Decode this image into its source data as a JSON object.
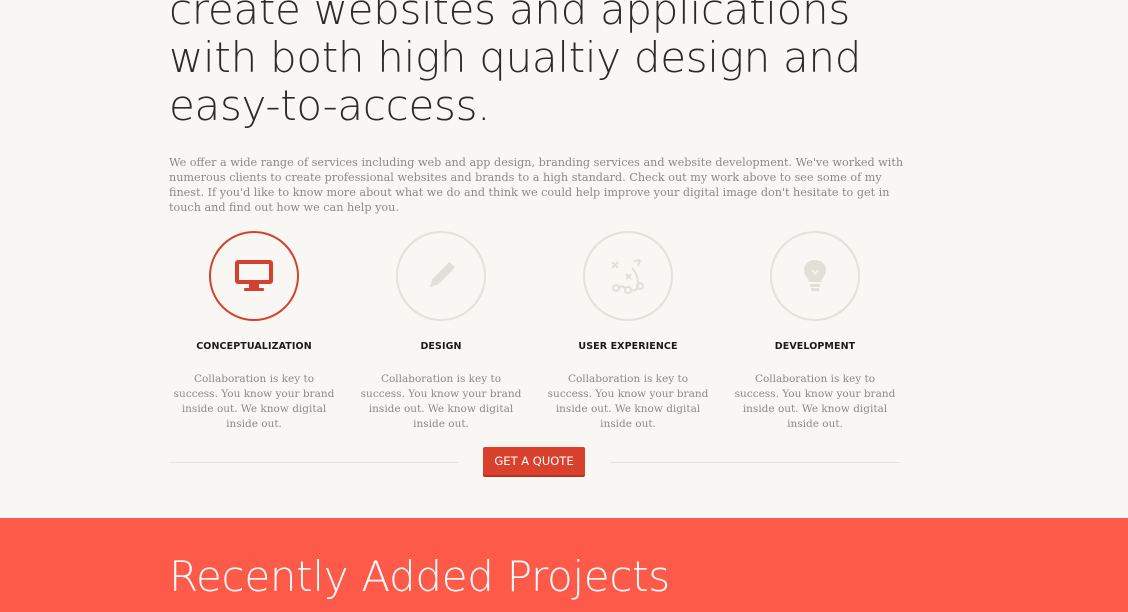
{
  "hero": {
    "lines": [
      "create websites and applications",
      "with both high qualtiy design and",
      "easy-to-access."
    ]
  },
  "intro": {
    "text": "We offer a wide range of services including web and app design, branding services and website development. We've worked with numerous clients to create professional websites and brands to a high standard. Check out my work above to see some of my finest. If you'd like to know more about what we do and think we could help improve your digital image don't hesitate to get in touch and find out how we can help you."
  },
  "services": [
    {
      "title": "CONCEPTUALIZATION",
      "icon": "monitor-icon",
      "desc": "Collaboration is key to success. You know your brand inside out. We know digital inside out."
    },
    {
      "title": "DESIGN",
      "icon": "pencil-icon",
      "desc": "Collaboration is key to success. You know your brand inside out. We know digital inside out."
    },
    {
      "title": "USER EXPERIENCE",
      "icon": "strategy-icon",
      "desc": "Collaboration is key to success. You know your brand inside out. We know digital inside out."
    },
    {
      "title": "DEVELOPMENT",
      "icon": "lightbulb-icon",
      "desc": "Collaboration is key to success. You know your brand inside out. We know digital inside out."
    }
  ],
  "cta": {
    "label": "GET A QUOTE"
  },
  "projects": {
    "title": "Recently Added Projects"
  },
  "colors": {
    "accent": "#d9412d",
    "projects_bg": "#fe5a4a",
    "page_bg": "#f9f7f3",
    "icon_inactive": "#e2ded8"
  }
}
